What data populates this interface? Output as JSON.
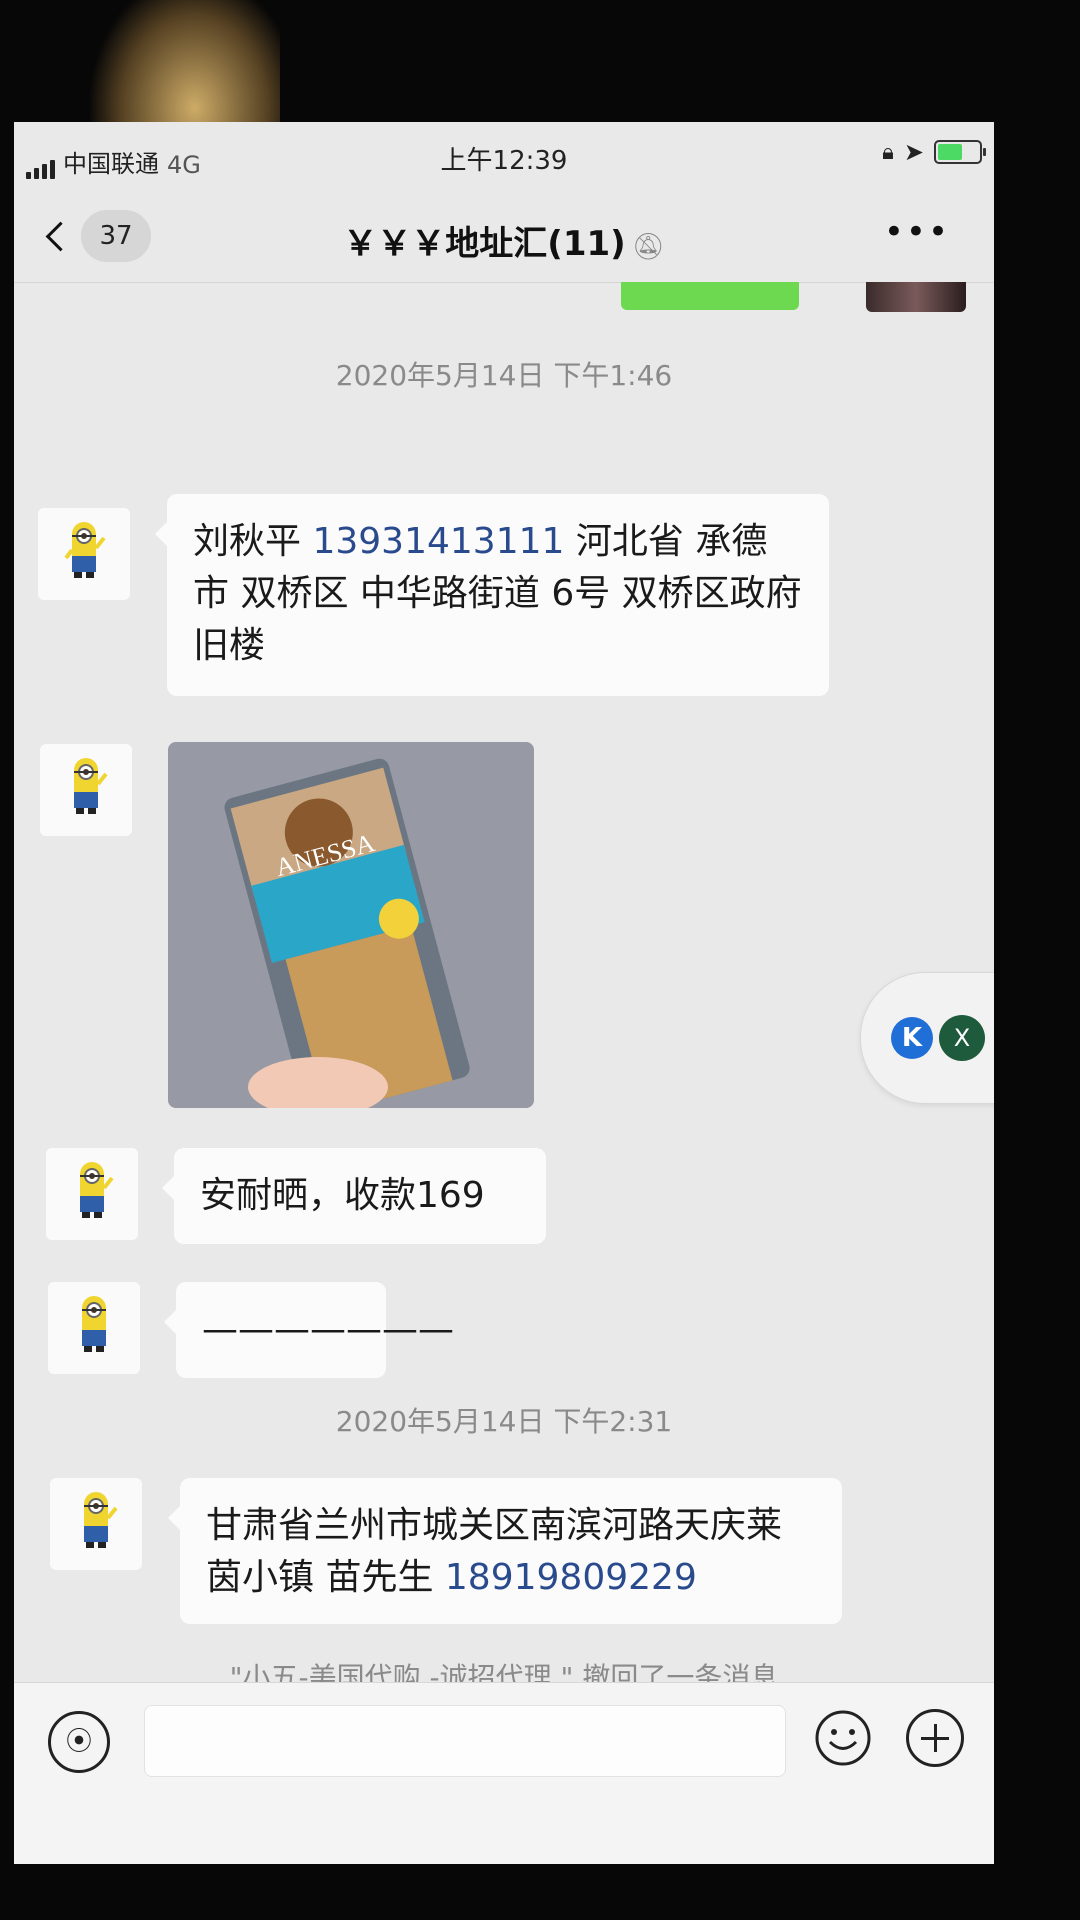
{
  "status_bar": {
    "carrier": "中国联通",
    "network": "4G",
    "time": "上午12:39",
    "battery_color": "#4cd964"
  },
  "nav": {
    "back_icon": "chevron-left-icon",
    "unread_count": "37",
    "title": "￥￥￥地址汇(11)",
    "mute_icon": "bell-slash-icon",
    "more_icon": "more-dots-icon"
  },
  "messages": {
    "time1": "2020年5月14日 下午1:46",
    "msg1_name": "刘秋平",
    "msg1_phone": "13931413111",
    "msg1_rest": "河北省 承德市 双桥区 中华路街道 6号 双桥区政府 旧楼",
    "msg2_image": "product-photo",
    "msg2_image_brand": "ANESSA",
    "msg3_text": "安耐晒，收款169",
    "msg4_text": "———————",
    "time2": "2020年5月14日 下午2:31",
    "msg5_text": "甘肃省兰州市城关区南滨河路天庆莱茵小镇 苗先生",
    "msg5_phone": "18919809229",
    "recall_notice": "\"小五-美国代购 -诚招代理.\" 撤回了一条消息",
    "bubble_color": "#fbfbfb",
    "self_bubble_color": "#6cd950",
    "link_color": "#2a4a8e"
  },
  "float_widget": {
    "icon1": "K",
    "icon2": "X"
  },
  "input_bar": {
    "voice_icon": "voice-icon",
    "emoji_icon": "emoji-icon",
    "plus_icon": "plus-icon"
  }
}
